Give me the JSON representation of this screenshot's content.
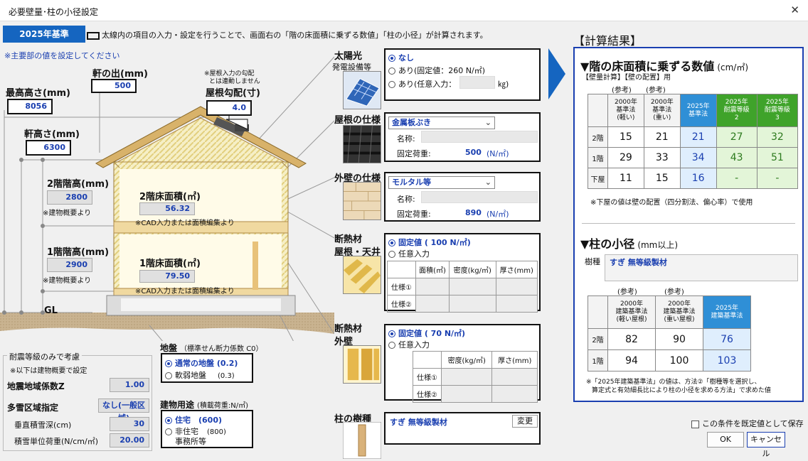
{
  "window": {
    "title": "必要壁量･柱の小径設定",
    "close": "✕"
  },
  "badge": "2025年基準",
  "header_note": "太線内の項目の入力・設定を行うことで、画面右の「階の床面積に乗ずる数値」「柱の小径」が計算されます。",
  "main_note": "※主要部の値を設定してください",
  "dims": {
    "eave_out": {
      "label": "軒の出(mm)",
      "value": "500"
    },
    "max_height": {
      "label": "最高高さ(mm)",
      "value": "8056"
    },
    "eave_height": {
      "label": "軒高さ(mm)",
      "value": "6300"
    },
    "roof_pitch": {
      "label": "屋根勾配(寸)",
      "value": "4.0",
      "note1": "※屋根入力の勾配",
      "note2": "とは連動しません"
    },
    "f2_height": {
      "label": "2階階高(mm)",
      "value": "2800",
      "note": "※建物概要より"
    },
    "f1_height": {
      "label": "1階階高(mm)",
      "value": "2900",
      "note": "※建物概要より"
    },
    "f2_area": {
      "label": "2階床面積(㎡)",
      "value": "56.32",
      "note": "※CAD入力または面積編集より"
    },
    "f1_area": {
      "label": "1階床面積(㎡)",
      "value": "79.50",
      "note": "※CAD入力または面積編集より"
    },
    "gl": "GL"
  },
  "seismic": {
    "title": "耐震等級のみで考慮",
    "note": "※以下は建物概要で設定",
    "zone_label": "地震地域係数Z",
    "zone_value": "1.00",
    "snow_label": "多雪区域指定",
    "snow_value": "なし(一般区域)",
    "depth_label": "垂直積雪深(cm)",
    "depth_value": "30",
    "load_label": "積雪単位荷重(N/cm/㎡)",
    "load_value": "20.00"
  },
  "ground": {
    "title": "地盤",
    "sub": "（標準せん断力係数 C0）",
    "opt1": "通常の地盤 (0.2)",
    "opt2": "軟弱地盤",
    "opt2v": "(0.3)"
  },
  "usage": {
    "title": "建物用途",
    "sub": "(積載荷重:N/㎡)",
    "opt1": "住宅　(600)",
    "opt2a": "非住宅",
    "opt2b": "事務所等",
    "opt2v": "(800)"
  },
  "solar": {
    "title": "太陽光",
    "sub": "発電設備等",
    "opt1": "なし",
    "opt2": "あり(固定値：260 N/㎡)",
    "opt3": "あり(任意入力：",
    "unit": "㎏)"
  },
  "roof": {
    "title": "屋根の仕様",
    "select": "金属板ぶき",
    "name_label": "名称:",
    "load_label": "固定荷重:",
    "load_value": "500",
    "unit": "(N/㎡)"
  },
  "wall": {
    "title": "外壁の仕様",
    "select": "モルタル等",
    "name_label": "名称:",
    "load_label": "固定荷重:",
    "load_value": "890",
    "unit": "(N/㎡)"
  },
  "insul_roof": {
    "title": "断熱材",
    "sub": "屋根・天井",
    "opt1": "固定値 ( 100 N/㎡)",
    "opt2": "任意入力",
    "cols": [
      "面積(㎡)",
      "密度(kg/㎥)",
      "厚さ(mm)"
    ],
    "rows": [
      "仕様①",
      "仕様②"
    ]
  },
  "insul_wall": {
    "title": "断熱材",
    "sub": "外壁",
    "opt1": "固定値 ( 70 N/㎡)",
    "opt2": "任意入力",
    "cols": [
      "密度(kg/㎥)",
      "厚さ(mm)"
    ],
    "rows": [
      "仕様①",
      "仕様②"
    ]
  },
  "column": {
    "title": "柱の樹種",
    "value": "すぎ 無等級製材",
    "btn": "変更"
  },
  "result": {
    "header": "【計算結果】",
    "floor_title": "▼階の床面積に乗ずる数値",
    "floor_unit": "(cm/㎡)",
    "floor_sub": "【壁量計算】【壁の配置】用",
    "ref": "(参考)",
    "cols": [
      "2000年\n基準法\n(軽い)",
      "2000年\n基準法\n(重い)",
      "2025年\n基準法",
      "2025年\n耐震等級\n2",
      "2025年\n耐震等級\n3"
    ],
    "rows": [
      {
        "label": "2階",
        "v": [
          "15",
          "21",
          "21",
          "27",
          "32"
        ]
      },
      {
        "label": "1階",
        "v": [
          "29",
          "33",
          "34",
          "43",
          "51"
        ]
      },
      {
        "label": "下屋",
        "v": [
          "11",
          "15",
          "16",
          "-",
          "-"
        ]
      }
    ],
    "floor_note": "※下屋の値は壁の配置（四分割法、偏心率）で使用",
    "col_title": "▼柱の小径",
    "col_unit": "(mm以上)",
    "species_label": "樹種",
    "species_value": "すぎ 無等級製材",
    "col_cols": [
      "2000年\n建築基準法\n(軽い屋根)",
      "2000年\n建築基準法\n(重い屋根)",
      "2025年\n建築基準法"
    ],
    "col_rows": [
      {
        "label": "2階",
        "v": [
          "82",
          "90",
          "76"
        ]
      },
      {
        "label": "1階",
        "v": [
          "94",
          "100",
          "103"
        ]
      }
    ],
    "col_note1": "※「2025年建築基準法」の値は、方法②「樹種等を選択し、",
    "col_note2": "算定式と有効細長比により柱の小径を求める方法」で求めた値"
  },
  "footer": {
    "save_default": "この条件を既定値として保存",
    "ok": "OK",
    "cancel": "キャンセル"
  }
}
